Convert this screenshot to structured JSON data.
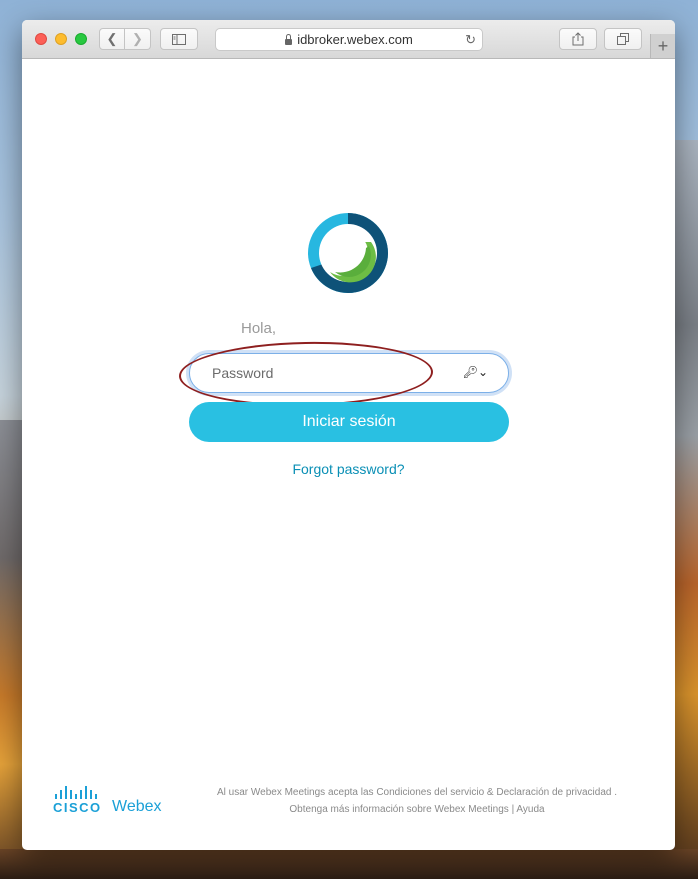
{
  "browser": {
    "url": "idbroker.webex.com",
    "controls": [
      "close",
      "minimize",
      "zoom"
    ],
    "icons": {
      "back": "chevron-left-icon",
      "forward": "chevron-right-icon",
      "sidebar": "sidebar-icon",
      "reload": "reload-icon",
      "share": "share-icon",
      "tabs": "tabs-icon",
      "new_tab": "plus-icon"
    }
  },
  "login": {
    "greeting": "Hola,",
    "password_placeholder": "Password",
    "signin_label": "Iniciar sesión",
    "forgot_label": "Forgot password?"
  },
  "brand": {
    "cisco": "CISCO",
    "webex": "Webex",
    "accent": "#29c0e2"
  },
  "footer": {
    "line1": "Al usar Webex Meetings acepta las Condiciones del servicio & Declaración de privacidad .",
    "line2_text": "Obtenga más información sobre Webex Meetings",
    "separator": "|",
    "help": "Ayuda"
  }
}
